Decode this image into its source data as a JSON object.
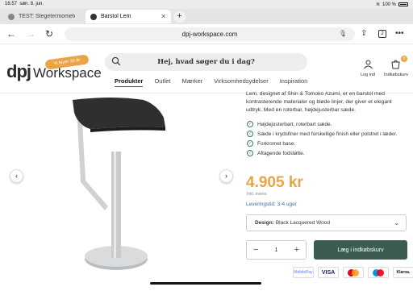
{
  "status": {
    "time": "16.57",
    "date": "søn. 8. jun.",
    "battery": "100 %"
  },
  "tabs": [
    {
      "label": "TEST: Stegetermometer"
    },
    {
      "label": "Barstol Lem"
    }
  ],
  "address": {
    "url": "dpj-workspace.com",
    "tab_count": "2"
  },
  "site": {
    "logo_mark": "dpj",
    "logo_text": "Workspace",
    "badge": "Vi fejrer 30 år",
    "search_placeholder": "Hej, hvad søger du i dag?",
    "login_label": "Log ind",
    "cart_label": "Indkøbskurv",
    "cart_count": "0",
    "menu": [
      "Produkter",
      "Outlet",
      "Mærker",
      "Virksomhedsydelser",
      "Inspiration"
    ]
  },
  "product": {
    "description": "Lem, designet af Shin & Tomoko Azumi, er en barstol med kontrasterende materialer og bløde linjer, der giver et elegant udtryk. Med en roterbar, højdejusterbar sæde.",
    "features": [
      "Højdejusterbart, roterbart sæde.",
      "Sæde i krydsfiner med forskellige finish eller polstret i læder.",
      "Forkromet base.",
      "Aftagende fodstøtte."
    ],
    "price": "4.905 kr",
    "vat_note": "Inkl. moms.",
    "delivery": "Leveringstid: 3-4 uger",
    "design_label": "Design:",
    "design_value": "Black Lacquered Wood",
    "quantity": "1",
    "add_to_cart": "Læg i indkøbskurv",
    "payments": [
      "MobilePay",
      "VISA",
      "Mastercard",
      "Maestro",
      "Klarna."
    ]
  },
  "colors": {
    "accent": "#e9a445",
    "brand_green": "#3c5b51",
    "link_blue": "#3e6fa8"
  }
}
